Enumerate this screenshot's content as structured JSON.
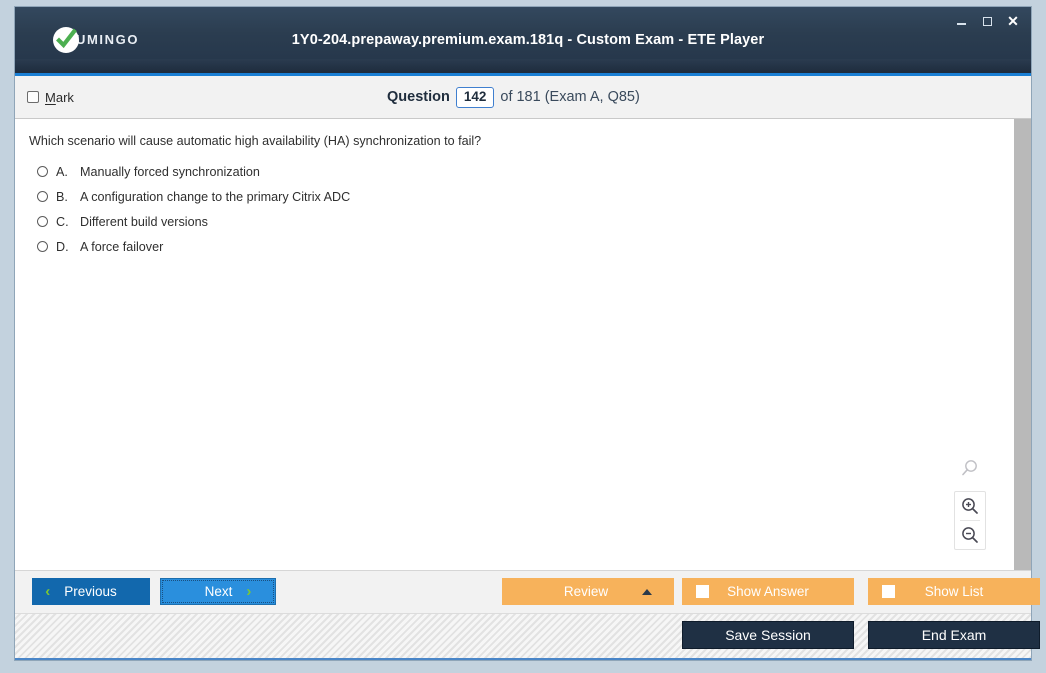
{
  "window": {
    "title": "1Y0-204.prepaway.premium.exam.181q - Custom Exam - ETE Player",
    "logo_text": "UMINGO",
    "controls": {
      "minimize": "minimize",
      "maximize": "maximize",
      "close": "close"
    }
  },
  "question_bar": {
    "mark_label_prefix": "M",
    "mark_label_rest": "ark",
    "question_word": "Question",
    "question_number": "142",
    "of_text": "of 181 (Exam A, Q85)"
  },
  "question": {
    "text": "Which scenario will cause automatic high availability (HA) synchronization to fail?",
    "choices": [
      {
        "letter": "A.",
        "text": "Manually forced synchronization"
      },
      {
        "letter": "B.",
        "text": "A configuration change to the primary Citrix ADC"
      },
      {
        "letter": "C.",
        "text": "Different build versions"
      },
      {
        "letter": "D.",
        "text": "A force failover"
      }
    ]
  },
  "zoom_tools": {
    "fit": "zoom-fit",
    "zoom_in": "zoom-in",
    "zoom_out": "zoom-out"
  },
  "toolbar": {
    "previous_label": "Previous",
    "next_label": "Next",
    "review_label": "Review",
    "show_answer_label": "Show Answer",
    "show_list_label": "Show List",
    "prev_chevron": "‹",
    "next_chevron": "›"
  },
  "footer": {
    "save_session_label": "Save Session",
    "end_exam_label": "End Exam"
  },
  "colors": {
    "titlebar": "#2b3d50",
    "accent_blue": "#1a7fd4",
    "orange": "#f7b25b",
    "dark_navy": "#1f3044",
    "green_check": "#4caf50"
  }
}
